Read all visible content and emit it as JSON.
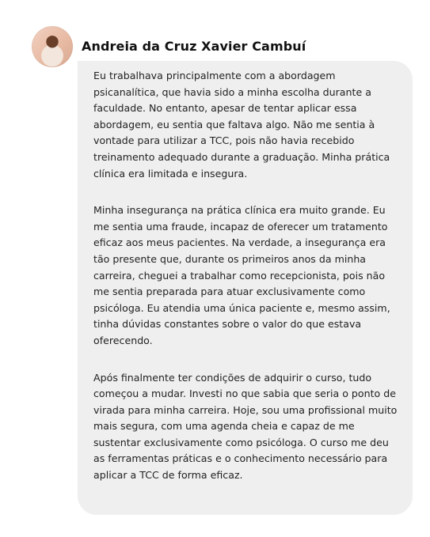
{
  "author": {
    "name": "Andreia da Cruz Xavier Cambuí"
  },
  "message": {
    "paragraphs": [
      "Eu trabalhava principalmente com a abordagem\npsicanalítica, que havia sido a minha escolha durante a\nfaculdade. No entanto, apesar de tentar aplicar essa\nabordagem, eu sentia que faltava algo. Não me sentia à\nvontade para utilizar a TCC, pois não havia recebido\ntreinamento adequado durante a graduação. Minha prática\nclínica era limitada e insegura.",
      "Minha insegurança na prática clínica era muito grande. Eu\nme sentia uma fraude, incapaz de oferecer um tratamento\neficaz aos meus pacientes. Na verdade, a insegurança era\ntão presente que, durante os primeiros anos da minha\ncarreira, cheguei a trabalhar como recepcionista, pois não\nme sentia preparada para atuar exclusivamente como\npsicóloga. Eu atendia uma única paciente e, mesmo assim,\ntinha dúvidas constantes sobre o valor do que estava\noferecendo.",
      "Após finalmente ter condições de adquirir o curso, tudo\ncomeçou a mudar. Investi no que sabia que seria o ponto de\nvirada para minha carreira. Hoje, sou uma profissional muito\nmais segura, com uma agenda cheia e capaz de me\nsustentar exclusivamente como psicóloga. O curso me deu\nas ferramentas práticas e o conhecimento necessário para\naplicar a TCC de forma eficaz."
    ]
  },
  "colors": {
    "bubble_background": "#efefef",
    "text": "#222222",
    "name": "#111111"
  }
}
